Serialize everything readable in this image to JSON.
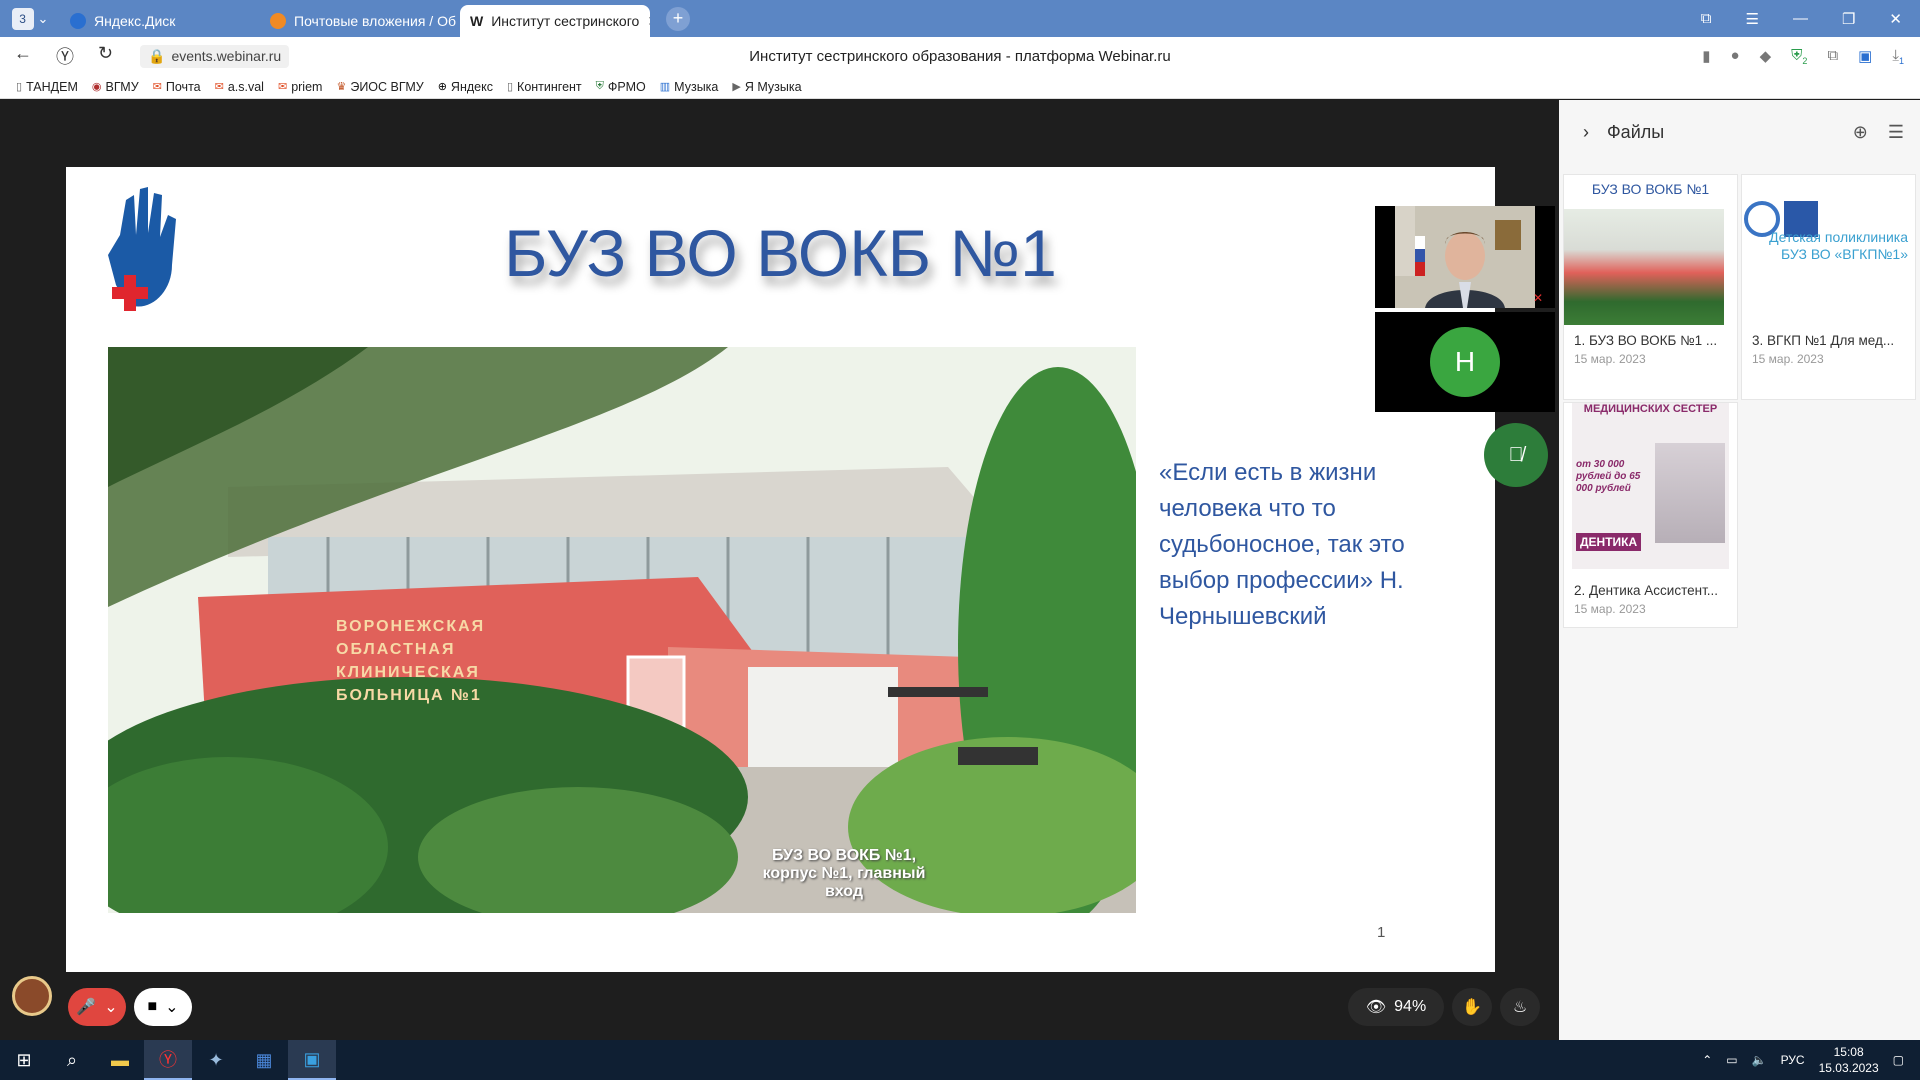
{
  "tabs": {
    "counter": "3",
    "items": [
      {
        "label": "Яндекс.Диск",
        "color": "#2a6fd0"
      },
      {
        "label": "Почтовые вложения / Об",
        "color": "#f08a24"
      },
      {
        "label": "Институт сестринского",
        "color": "#222222",
        "icon": "W"
      }
    ]
  },
  "addressbar": {
    "url": "events.webinar.ru",
    "page_title": "Институт сестринского образования - платформа Webinar.ru",
    "download_badge": "1",
    "ext_badge": "2"
  },
  "bookmarks": [
    "ТАНДЕМ",
    "ВГМУ",
    "Почта",
    "a.s.val",
    "priem",
    "ЭИОС ВГМУ",
    "Яндекс",
    "Контингент",
    "ФРМО",
    "Музыка",
    "Я Музыка"
  ],
  "slide": {
    "title": "БУЗ ВО ВОКБ №1",
    "quote": "«Если есть в жизни человека что то судьбоносное, так это выбор профессии» Н. Чернышевский",
    "photo_sign": "ВОРОНЕЖСКАЯ ОБЛАСТНАЯ КЛИНИЧЕСКАЯ БОЛЬНИЦА №1",
    "photo_caption": "БУЗ ВО ВОКБ №1, корпус №1, главный вход",
    "page_number": "1"
  },
  "participants": {
    "avatar_letter": "Н"
  },
  "files_panel": {
    "title": "Файлы",
    "items": [
      {
        "name": "1. БУЗ ВО ВОКБ №1 ...",
        "date": "15 мар. 2023",
        "thumb_title": "БУЗ ВО ВОКБ №1"
      },
      {
        "name": "3. ВГКП №1 Для мед...",
        "date": "15 мар. 2023",
        "thumb_title": "Детская поликлиника БУЗ ВО «ВГКП№1»"
      },
      {
        "name": "2. Дентика Ассистент...",
        "date": "15 мар. 2023",
        "thumb_title": "МЕДИЦИНСКИХ СЕСТЕР",
        "thumb_salary": "от 30 000 рублей до 65 000 рублей",
        "thumb_brand": "ДЕНТИКА"
      }
    ]
  },
  "controls": {
    "attendance": "94%"
  },
  "taskbar": {
    "lang": "РУС",
    "time": "15:08",
    "date": "15.03.2023"
  },
  "colors": {
    "tabbar": "#5b86c4",
    "slide_title": "#2f57a0",
    "mic_off": "#e0463f",
    "avatar": "#3aa640"
  }
}
